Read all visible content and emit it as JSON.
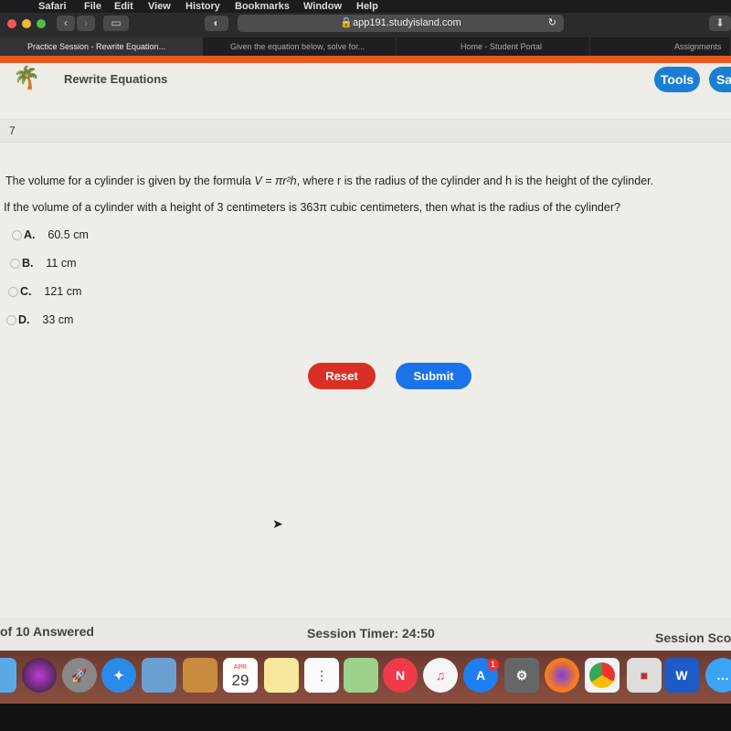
{
  "menubar": {
    "items": [
      "Safari",
      "File",
      "Edit",
      "View",
      "History",
      "Bookmarks",
      "Window",
      "Help"
    ]
  },
  "browser": {
    "url": "app191.studyisland.com",
    "tabs": [
      {
        "label": "Practice Session - Rewrite Equation..."
      },
      {
        "label": "Given the equation below, solve for..."
      },
      {
        "label": "Home - Student Portal"
      },
      {
        "label": "Assignments"
      }
    ]
  },
  "header": {
    "title": "Rewrite Equations",
    "tools_label": "Tools",
    "save_label": "Sa"
  },
  "question": {
    "number": "7",
    "line1_pre": "The volume for a cylinder is given by the formula ",
    "formula": "V = πr²h",
    "line1_post": ", where r is the radius of the cylinder and h is the height of the cylinder.",
    "line2": "If the volume of a cylinder with a height of 3 centimeters is 363π cubic centimeters, then what is the radius of the cylinder?",
    "options": [
      {
        "letter": "A.",
        "text": "60.5 cm"
      },
      {
        "letter": "B.",
        "text": "11 cm"
      },
      {
        "letter": "C.",
        "text": "121 cm"
      },
      {
        "letter": "D.",
        "text": "33 cm"
      }
    ]
  },
  "buttons": {
    "reset": "Reset",
    "submit": "Submit"
  },
  "footer": {
    "answered": "of 10 Answered",
    "timer": "Session Timer: 24:50",
    "score": "Session Sco"
  },
  "dock": {
    "calendar_month": "APR",
    "calendar_day": "29",
    "appstore_badge": "1",
    "apps": [
      "finder",
      "siri",
      "launchpad",
      "safari",
      "preview",
      "contacts",
      "calendar",
      "notes",
      "reminders",
      "maps",
      "news",
      "music",
      "app-store",
      "system-preferences",
      "firefox",
      "chrome",
      "roblox",
      "word",
      "messages"
    ]
  },
  "colors": {
    "accent_orange": "#e9581f",
    "reset_red": "#d93025",
    "submit_blue": "#1a73e8",
    "tools_blue": "#1a7fd4"
  }
}
